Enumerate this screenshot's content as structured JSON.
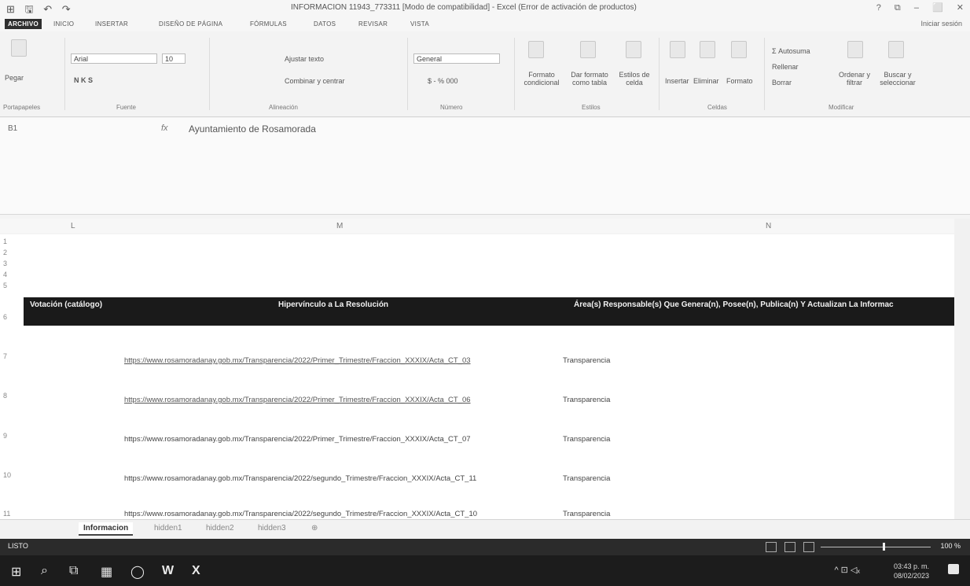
{
  "window": {
    "title": "INFORMACION 11943_773311 [Modo de compatibilidad] - Excel (Error de activación de productos)",
    "controls": [
      "?",
      "⧉",
      "–",
      "⬜",
      "✕"
    ]
  },
  "quick_access": [
    "⊞",
    "🖫",
    "↶",
    "↷"
  ],
  "ribbon_tabs": [
    "ARCHIVO",
    "INICIO",
    "INSERTAR",
    "DISEÑO DE PÁGINA",
    "FÓRMULAS",
    "DATOS",
    "REVISAR",
    "VISTA"
  ],
  "signin": "Iniciar sesión",
  "ribbon": {
    "font_name": "Arial",
    "font_size": "10",
    "paste_label": "Pegar",
    "bold_italic": "N K S",
    "wrap_text": "Ajustar texto",
    "merge_center": "Combinar y centrar",
    "number_format": "General",
    "number_buttons": "$ - % 000",
    "cond_format": "Formato condicional",
    "format_table": "Dar formato como tabla",
    "cell_styles": "Estilos de celda",
    "insert": "Insertar",
    "delete": "Eliminar",
    "format": "Formato",
    "autosum": "Autosuma",
    "fill": "Rellenar",
    "clear": "Borrar",
    "sort_filter": "Ordenar y filtrar",
    "find_select": "Buscar y seleccionar",
    "groups": [
      "Portapapeles",
      "Fuente",
      "Alineación",
      "Número",
      "Estilos",
      "Celdas",
      "Modificar"
    ]
  },
  "formula_bar": {
    "name_box": "B1",
    "fx": "fx",
    "formula": "Ayuntamiento de Rosamorada"
  },
  "columns": [
    "L",
    "M",
    "N"
  ],
  "rows": [
    "1",
    "2",
    "3",
    "4",
    "5",
    "6",
    "7",
    "8",
    "9",
    "10",
    "11"
  ],
  "table": {
    "headers": [
      "Votación (catálogo)",
      "Hipervínculo a La Resolución",
      "Área(s) Responsable(s) Que Genera(n), Posee(n), Publica(n) Y Actualizan La Informac"
    ],
    "rows": [
      {
        "link": "https://www.rosamoradanay.gob.mx/Transparencia/2022/Primer_Trimestre/Fraccion_XXXIX/Acta_CT_03",
        "area": "Transparencia"
      },
      {
        "link": "https://www.rosamoradanay.gob.mx/Transparencia/2022/Primer_Trimestre/Fraccion_XXXIX/Acta_CT_06",
        "area": "Transparencia"
      },
      {
        "link": "https://www.rosamoradanay.gob.mx/Transparencia/2022/Primer_Trimestre/Fraccion_XXXIX/Acta_CT_07",
        "area": "Transparencia"
      },
      {
        "link": "https://www.rosamoradanay.gob.mx/Transparencia/2022/segundo_Trimestre/Fraccion_XXXIX/Acta_CT_11",
        "area": "Transparencia"
      },
      {
        "link": "https://www.rosamoradanay.gob.mx/Transparencia/2022/segundo_Trimestre/Fraccion_XXXIX/Acta_CT_10",
        "area": "Transparencia"
      }
    ]
  },
  "sheet_tabs": [
    "Informacion",
    "hidden1",
    "hidden2",
    "hidden3"
  ],
  "add_sheet": "⊕",
  "status": {
    "text": "LISTO",
    "zoom": "100 %"
  },
  "taskbar": {
    "icons": [
      "⊞",
      "⌕",
      "⧉",
      "▦",
      "◯",
      "W",
      "X"
    ],
    "time": "03:43 p. m.",
    "date": "08/02/2023",
    "tray": "^ ⊡ ◁ₓ"
  }
}
